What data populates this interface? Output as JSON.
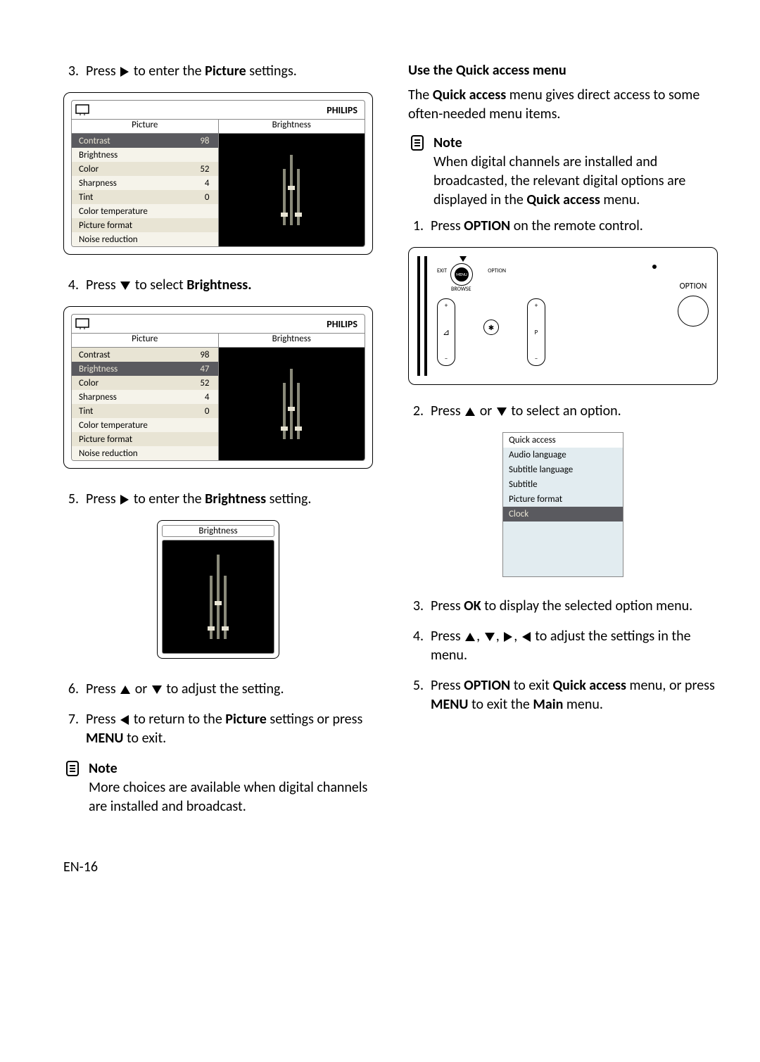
{
  "left": {
    "step3": {
      "n": "3.",
      "pre": "Press ",
      "post": " to enter the ",
      "bold": "Picture",
      "tail": " settings."
    },
    "osd1": {
      "brand": "PHILIPS",
      "left_header": "Picture",
      "right_header": "Brightness",
      "rows": [
        {
          "label": "Contrast",
          "value": "98",
          "selected": true
        },
        {
          "label": "Brightness",
          "value": "",
          "selected": false
        },
        {
          "label": "Color",
          "value": "52",
          "selected": false
        },
        {
          "label": "Sharpness",
          "value": "4",
          "selected": false
        },
        {
          "label": "Tint",
          "value": "0",
          "selected": false
        },
        {
          "label": "Color temperature",
          "value": "",
          "selected": false
        },
        {
          "label": "Picture format",
          "value": "",
          "selected": false
        },
        {
          "label": "Noise reduction",
          "value": "",
          "selected": false
        }
      ]
    },
    "step4": {
      "n": "4.",
      "pre": "Press ",
      "post": " to select ",
      "bold": "Brightness."
    },
    "osd2": {
      "brand": "PHILIPS",
      "left_header": "Picture",
      "right_header": "Brightness",
      "rows": [
        {
          "label": "Contrast",
          "value": "98",
          "selected": false
        },
        {
          "label": "Brightness",
          "value": "47",
          "selected": true
        },
        {
          "label": "Color",
          "value": "52",
          "selected": false
        },
        {
          "label": "Sharpness",
          "value": "4",
          "selected": false
        },
        {
          "label": "Tint",
          "value": "0",
          "selected": false
        },
        {
          "label": "Color temperature",
          "value": "",
          "selected": false
        },
        {
          "label": "Picture format",
          "value": "",
          "selected": false
        },
        {
          "label": "Noise reduction",
          "value": "",
          "selected": false
        }
      ]
    },
    "step5": {
      "n": "5.",
      "pre": "Press ",
      "post": " to enter the ",
      "bold": "Brightness",
      "tail": " setting."
    },
    "mini_title": "Brightness",
    "step6": {
      "n": "6.",
      "pre": "Press ",
      "mid": " or ",
      "post": " to adjust the setting."
    },
    "step7": {
      "n": "7.",
      "pre": "Press ",
      "post": " to return to the ",
      "bold": "Picture",
      "mid2": " settings or press ",
      "bold2": "MENU",
      "tail": " to exit."
    },
    "note": {
      "label": "Note",
      "body": "More choices are available when digital channels are installed and broadcast."
    }
  },
  "right": {
    "heading": "Use the Quick access menu",
    "intro": {
      "pre": "The ",
      "b1": "Quick access",
      "post": " menu gives direct access to some often-needed menu items."
    },
    "note": {
      "label": "Note",
      "pre": "When digital channels are installed and broadcasted, the relevant digital options are displayed in the ",
      "bold": "Quick access",
      "post": " menu."
    },
    "step1": {
      "n": "1.",
      "pre": "Press ",
      "bold": "OPTION",
      "post": " on the remote control."
    },
    "remote": {
      "exit": "EXIT",
      "option_small": "OPTION",
      "menu": "MENU",
      "browse": "BROWSE",
      "mute": "✱",
      "p": "P",
      "option_big": "OPTION"
    },
    "step2": {
      "n": "2.",
      "pre": "Press ",
      "mid": " or ",
      "post": " to select an option."
    },
    "qa": {
      "header": "Quick access",
      "rows": [
        {
          "label": "Audio language",
          "selected": false
        },
        {
          "label": "Subtitle language",
          "selected": false
        },
        {
          "label": "Subtitle",
          "selected": false
        },
        {
          "label": "Picture format",
          "selected": false
        },
        {
          "label": "Clock",
          "selected": true
        }
      ]
    },
    "step3": {
      "n": "3.",
      "pre": "Press ",
      "bold": "OK",
      "post": " to display the selected option menu."
    },
    "step4": {
      "n": "4.",
      "pre": "Press ",
      "post": " to adjust the settings in the menu."
    },
    "step5": {
      "n": "5.",
      "pre": "Press ",
      "b1": "OPTION",
      "m1": " to exit ",
      "b2": "Quick access",
      "m2": " menu, or press ",
      "b3": "MENU",
      "m3": " to exit the ",
      "b4": "Main",
      "tail": " menu."
    }
  },
  "footer": "EN-16"
}
